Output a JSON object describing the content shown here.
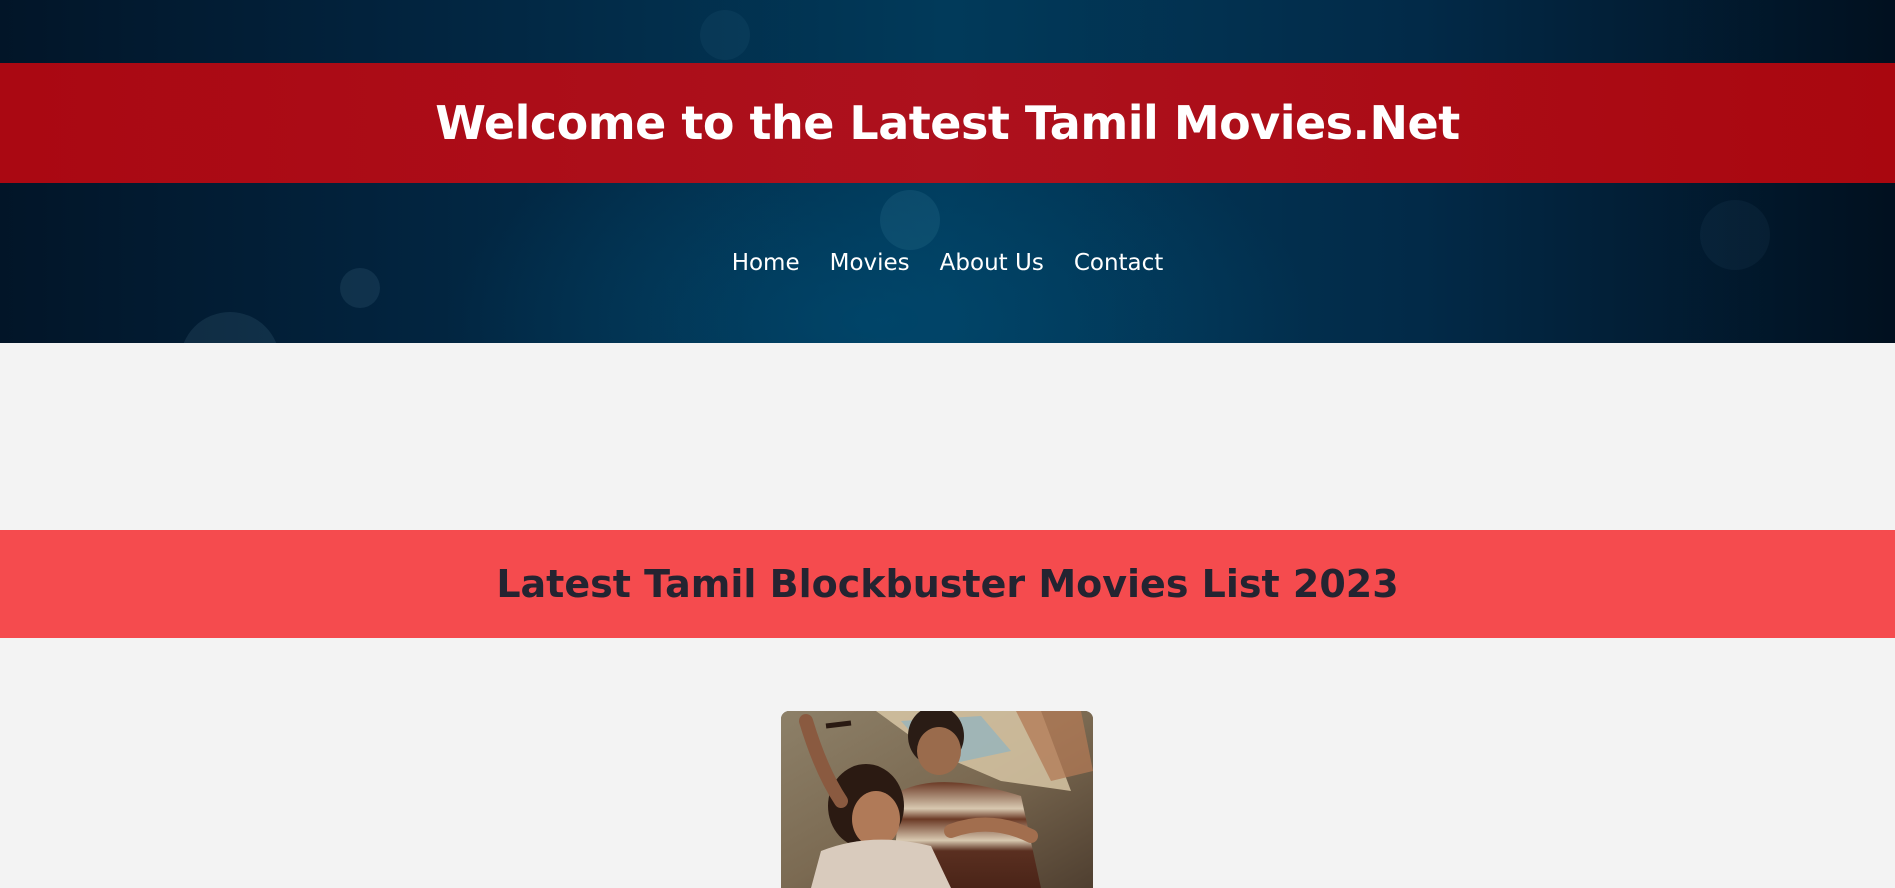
{
  "header": {
    "title": "Welcome to the Latest Tamil Movies.Net"
  },
  "nav": {
    "items": [
      {
        "label": "Home"
      },
      {
        "label": "Movies"
      },
      {
        "label": "About Us"
      },
      {
        "label": "Contact"
      }
    ]
  },
  "section": {
    "heading": "Latest Tamil Blockbuster Movies List 2023"
  },
  "colors": {
    "title_band": "#aa0812",
    "section_band": "#f54b4e",
    "page_bg": "#f3f3f3",
    "hero_bg": "#013a5a"
  },
  "poster": {
    "icon": "movie-poster-image"
  }
}
